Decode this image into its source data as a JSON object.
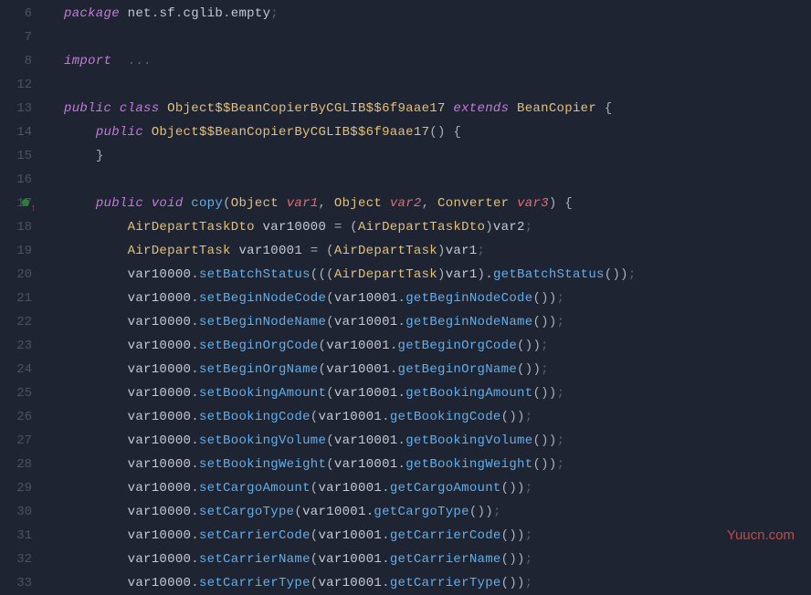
{
  "watermark": "Yuucn.com",
  "gutter": [
    "6",
    "7",
    "8",
    "12",
    "13",
    "14",
    "15",
    "16",
    "17",
    "18",
    "19",
    "20",
    "21",
    "22",
    "23",
    "24",
    "25",
    "26",
    "27",
    "28",
    "29",
    "30",
    "31",
    "32",
    "33"
  ],
  "marker_index": 8,
  "lines": [
    {
      "indent": 0,
      "tokens": [
        {
          "c": "kw",
          "t": "package"
        },
        {
          "c": "pkg",
          "t": " net"
        },
        {
          "c": "dot",
          "t": "."
        },
        {
          "c": "pkg",
          "t": "sf"
        },
        {
          "c": "dot",
          "t": "."
        },
        {
          "c": "pkg",
          "t": "cglib"
        },
        {
          "c": "dot",
          "t": "."
        },
        {
          "c": "pkg",
          "t": "empty"
        },
        {
          "c": "semi",
          "t": ";"
        }
      ]
    },
    {
      "indent": 0,
      "tokens": []
    },
    {
      "indent": 0,
      "tokens": [
        {
          "c": "kw",
          "t": "import"
        },
        {
          "c": "pkg",
          "t": "  "
        },
        {
          "c": "semi",
          "t": "..."
        }
      ]
    },
    {
      "indent": 0,
      "tokens": []
    },
    {
      "indent": 0,
      "tokens": [
        {
          "c": "kw",
          "t": "public"
        },
        {
          "c": "pkg",
          "t": " "
        },
        {
          "c": "kw",
          "t": "class"
        },
        {
          "c": "pkg",
          "t": " "
        },
        {
          "c": "type",
          "t": "Object$$BeanCopierByCGLIB$$6f9aae17"
        },
        {
          "c": "pkg",
          "t": " "
        },
        {
          "c": "kw",
          "t": "extends"
        },
        {
          "c": "pkg",
          "t": " "
        },
        {
          "c": "type",
          "t": "BeanCopier"
        },
        {
          "c": "pkg",
          "t": " "
        },
        {
          "c": "punct",
          "t": "{"
        }
      ]
    },
    {
      "indent": 1,
      "tokens": [
        {
          "c": "kw",
          "t": "public"
        },
        {
          "c": "pkg",
          "t": " "
        },
        {
          "c": "type",
          "t": "Object$$BeanCopierByCGLIB$$6f9aae17"
        },
        {
          "c": "punct",
          "t": "()"
        },
        {
          "c": "pkg",
          "t": " "
        },
        {
          "c": "punct",
          "t": "{"
        }
      ]
    },
    {
      "indent": 1,
      "tokens": [
        {
          "c": "punct",
          "t": "}"
        }
      ]
    },
    {
      "indent": 0,
      "tokens": []
    },
    {
      "indent": 1,
      "tokens": [
        {
          "c": "kw",
          "t": "public"
        },
        {
          "c": "pkg",
          "t": " "
        },
        {
          "c": "kw",
          "t": "void"
        },
        {
          "c": "pkg",
          "t": " "
        },
        {
          "c": "fn",
          "t": "copy"
        },
        {
          "c": "punct",
          "t": "("
        },
        {
          "c": "type",
          "t": "Object"
        },
        {
          "c": "pkg",
          "t": " "
        },
        {
          "c": "param",
          "t": "var1"
        },
        {
          "c": "punct",
          "t": ", "
        },
        {
          "c": "type",
          "t": "Object"
        },
        {
          "c": "pkg",
          "t": " "
        },
        {
          "c": "param",
          "t": "var2"
        },
        {
          "c": "punct",
          "t": ", "
        },
        {
          "c": "type",
          "t": "Converter"
        },
        {
          "c": "pkg",
          "t": " "
        },
        {
          "c": "param",
          "t": "var3"
        },
        {
          "c": "punct",
          "t": ")"
        },
        {
          "c": "pkg",
          "t": " "
        },
        {
          "c": "punct",
          "t": "{"
        }
      ]
    },
    {
      "indent": 2,
      "tokens": [
        {
          "c": "type",
          "t": "AirDepartTaskDto"
        },
        {
          "c": "pkg",
          "t": " var10000 "
        },
        {
          "c": "punct",
          "t": "="
        },
        {
          "c": "pkg",
          "t": " "
        },
        {
          "c": "punct",
          "t": "("
        },
        {
          "c": "type",
          "t": "AirDepartTaskDto"
        },
        {
          "c": "punct",
          "t": ")"
        },
        {
          "c": "pkg",
          "t": "var2"
        },
        {
          "c": "semi",
          "t": ";"
        }
      ]
    },
    {
      "indent": 2,
      "tokens": [
        {
          "c": "type",
          "t": "AirDepartTask"
        },
        {
          "c": "pkg",
          "t": " var10001 "
        },
        {
          "c": "punct",
          "t": "="
        },
        {
          "c": "pkg",
          "t": " "
        },
        {
          "c": "punct",
          "t": "("
        },
        {
          "c": "type",
          "t": "AirDepartTask"
        },
        {
          "c": "punct",
          "t": ")"
        },
        {
          "c": "pkg",
          "t": "var1"
        },
        {
          "c": "semi",
          "t": ";"
        }
      ]
    },
    {
      "indent": 2,
      "tokens": [
        {
          "c": "pkg",
          "t": "var10000"
        },
        {
          "c": "dot",
          "t": "."
        },
        {
          "c": "fn",
          "t": "setBatchStatus"
        },
        {
          "c": "punct",
          "t": "((("
        },
        {
          "c": "type",
          "t": "AirDepartTask"
        },
        {
          "c": "punct",
          "t": ")"
        },
        {
          "c": "pkg",
          "t": "var1"
        },
        {
          "c": "punct",
          "t": ")"
        },
        {
          "c": "dot",
          "t": "."
        },
        {
          "c": "fn",
          "t": "getBatchStatus"
        },
        {
          "c": "punct",
          "t": "())"
        },
        {
          "c": "semi",
          "t": ";"
        }
      ]
    },
    {
      "indent": 2,
      "tokens": [
        {
          "c": "pkg",
          "t": "var10000"
        },
        {
          "c": "dot",
          "t": "."
        },
        {
          "c": "fn",
          "t": "setBeginNodeCode"
        },
        {
          "c": "punct",
          "t": "("
        },
        {
          "c": "pkg",
          "t": "var10001"
        },
        {
          "c": "dot",
          "t": "."
        },
        {
          "c": "fn",
          "t": "getBeginNodeCode"
        },
        {
          "c": "punct",
          "t": "())"
        },
        {
          "c": "semi",
          "t": ";"
        }
      ]
    },
    {
      "indent": 2,
      "tokens": [
        {
          "c": "pkg",
          "t": "var10000"
        },
        {
          "c": "dot",
          "t": "."
        },
        {
          "c": "fn",
          "t": "setBeginNodeName"
        },
        {
          "c": "punct",
          "t": "("
        },
        {
          "c": "pkg",
          "t": "var10001"
        },
        {
          "c": "dot",
          "t": "."
        },
        {
          "c": "fn",
          "t": "getBeginNodeName"
        },
        {
          "c": "punct",
          "t": "())"
        },
        {
          "c": "semi",
          "t": ";"
        }
      ]
    },
    {
      "indent": 2,
      "tokens": [
        {
          "c": "pkg",
          "t": "var10000"
        },
        {
          "c": "dot",
          "t": "."
        },
        {
          "c": "fn",
          "t": "setBeginOrgCode"
        },
        {
          "c": "punct",
          "t": "("
        },
        {
          "c": "pkg",
          "t": "var10001"
        },
        {
          "c": "dot",
          "t": "."
        },
        {
          "c": "fn",
          "t": "getBeginOrgCode"
        },
        {
          "c": "punct",
          "t": "())"
        },
        {
          "c": "semi",
          "t": ";"
        }
      ]
    },
    {
      "indent": 2,
      "tokens": [
        {
          "c": "pkg",
          "t": "var10000"
        },
        {
          "c": "dot",
          "t": "."
        },
        {
          "c": "fn",
          "t": "setBeginOrgName"
        },
        {
          "c": "punct",
          "t": "("
        },
        {
          "c": "pkg",
          "t": "var10001"
        },
        {
          "c": "dot",
          "t": "."
        },
        {
          "c": "fn",
          "t": "getBeginOrgName"
        },
        {
          "c": "punct",
          "t": "())"
        },
        {
          "c": "semi",
          "t": ";"
        }
      ]
    },
    {
      "indent": 2,
      "tokens": [
        {
          "c": "pkg",
          "t": "var10000"
        },
        {
          "c": "dot",
          "t": "."
        },
        {
          "c": "fn",
          "t": "setBookingAmount"
        },
        {
          "c": "punct",
          "t": "("
        },
        {
          "c": "pkg",
          "t": "var10001"
        },
        {
          "c": "dot",
          "t": "."
        },
        {
          "c": "fn",
          "t": "getBookingAmount"
        },
        {
          "c": "punct",
          "t": "())"
        },
        {
          "c": "semi",
          "t": ";"
        }
      ]
    },
    {
      "indent": 2,
      "tokens": [
        {
          "c": "pkg",
          "t": "var10000"
        },
        {
          "c": "dot",
          "t": "."
        },
        {
          "c": "fn",
          "t": "setBookingCode"
        },
        {
          "c": "punct",
          "t": "("
        },
        {
          "c": "pkg",
          "t": "var10001"
        },
        {
          "c": "dot",
          "t": "."
        },
        {
          "c": "fn",
          "t": "getBookingCode"
        },
        {
          "c": "punct",
          "t": "())"
        },
        {
          "c": "semi",
          "t": ";"
        }
      ]
    },
    {
      "indent": 2,
      "tokens": [
        {
          "c": "pkg",
          "t": "var10000"
        },
        {
          "c": "dot",
          "t": "."
        },
        {
          "c": "fn",
          "t": "setBookingVolume"
        },
        {
          "c": "punct",
          "t": "("
        },
        {
          "c": "pkg",
          "t": "var10001"
        },
        {
          "c": "dot",
          "t": "."
        },
        {
          "c": "fn",
          "t": "getBookingVolume"
        },
        {
          "c": "punct",
          "t": "())"
        },
        {
          "c": "semi",
          "t": ";"
        }
      ]
    },
    {
      "indent": 2,
      "tokens": [
        {
          "c": "pkg",
          "t": "var10000"
        },
        {
          "c": "dot",
          "t": "."
        },
        {
          "c": "fn",
          "t": "setBookingWeight"
        },
        {
          "c": "punct",
          "t": "("
        },
        {
          "c": "pkg",
          "t": "var10001"
        },
        {
          "c": "dot",
          "t": "."
        },
        {
          "c": "fn",
          "t": "getBookingWeight"
        },
        {
          "c": "punct",
          "t": "())"
        },
        {
          "c": "semi",
          "t": ";"
        }
      ]
    },
    {
      "indent": 2,
      "tokens": [
        {
          "c": "pkg",
          "t": "var10000"
        },
        {
          "c": "dot",
          "t": "."
        },
        {
          "c": "fn",
          "t": "setCargoAmount"
        },
        {
          "c": "punct",
          "t": "("
        },
        {
          "c": "pkg",
          "t": "var10001"
        },
        {
          "c": "dot",
          "t": "."
        },
        {
          "c": "fn",
          "t": "getCargoAmount"
        },
        {
          "c": "punct",
          "t": "())"
        },
        {
          "c": "semi",
          "t": ";"
        }
      ]
    },
    {
      "indent": 2,
      "tokens": [
        {
          "c": "pkg",
          "t": "var10000"
        },
        {
          "c": "dot",
          "t": "."
        },
        {
          "c": "fn",
          "t": "setCargoType"
        },
        {
          "c": "punct",
          "t": "("
        },
        {
          "c": "pkg",
          "t": "var10001"
        },
        {
          "c": "dot",
          "t": "."
        },
        {
          "c": "fn",
          "t": "getCargoType"
        },
        {
          "c": "punct",
          "t": "())"
        },
        {
          "c": "semi",
          "t": ";"
        }
      ]
    },
    {
      "indent": 2,
      "tokens": [
        {
          "c": "pkg",
          "t": "var10000"
        },
        {
          "c": "dot",
          "t": "."
        },
        {
          "c": "fn",
          "t": "setCarrierCode"
        },
        {
          "c": "punct",
          "t": "("
        },
        {
          "c": "pkg",
          "t": "var10001"
        },
        {
          "c": "dot",
          "t": "."
        },
        {
          "c": "fn",
          "t": "getCarrierCode"
        },
        {
          "c": "punct",
          "t": "())"
        },
        {
          "c": "semi",
          "t": ";"
        }
      ]
    },
    {
      "indent": 2,
      "tokens": [
        {
          "c": "pkg",
          "t": "var10000"
        },
        {
          "c": "dot",
          "t": "."
        },
        {
          "c": "fn",
          "t": "setCarrierName"
        },
        {
          "c": "punct",
          "t": "("
        },
        {
          "c": "pkg",
          "t": "var10001"
        },
        {
          "c": "dot",
          "t": "."
        },
        {
          "c": "fn",
          "t": "getCarrierName"
        },
        {
          "c": "punct",
          "t": "())"
        },
        {
          "c": "semi",
          "t": ";"
        }
      ]
    },
    {
      "indent": 2,
      "tokens": [
        {
          "c": "pkg",
          "t": "var10000"
        },
        {
          "c": "dot",
          "t": "."
        },
        {
          "c": "fn",
          "t": "setCarrierType"
        },
        {
          "c": "punct",
          "t": "("
        },
        {
          "c": "pkg",
          "t": "var10001"
        },
        {
          "c": "dot",
          "t": "."
        },
        {
          "c": "fn",
          "t": "getCarrierType"
        },
        {
          "c": "punct",
          "t": "())"
        },
        {
          "c": "semi",
          "t": ";"
        }
      ]
    }
  ]
}
